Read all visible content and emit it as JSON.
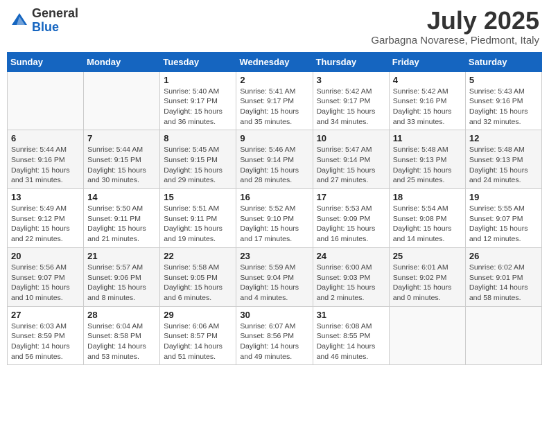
{
  "header": {
    "logo_general": "General",
    "logo_blue": "Blue",
    "month_year": "July 2025",
    "location": "Garbagna Novarese, Piedmont, Italy"
  },
  "calendar": {
    "days_of_week": [
      "Sunday",
      "Monday",
      "Tuesday",
      "Wednesday",
      "Thursday",
      "Friday",
      "Saturday"
    ],
    "weeks": [
      [
        {
          "day": "",
          "info": ""
        },
        {
          "day": "",
          "info": ""
        },
        {
          "day": "1",
          "info": "Sunrise: 5:40 AM\nSunset: 9:17 PM\nDaylight: 15 hours\nand 36 minutes."
        },
        {
          "day": "2",
          "info": "Sunrise: 5:41 AM\nSunset: 9:17 PM\nDaylight: 15 hours\nand 35 minutes."
        },
        {
          "day": "3",
          "info": "Sunrise: 5:42 AM\nSunset: 9:17 PM\nDaylight: 15 hours\nand 34 minutes."
        },
        {
          "day": "4",
          "info": "Sunrise: 5:42 AM\nSunset: 9:16 PM\nDaylight: 15 hours\nand 33 minutes."
        },
        {
          "day": "5",
          "info": "Sunrise: 5:43 AM\nSunset: 9:16 PM\nDaylight: 15 hours\nand 32 minutes."
        }
      ],
      [
        {
          "day": "6",
          "info": "Sunrise: 5:44 AM\nSunset: 9:16 PM\nDaylight: 15 hours\nand 31 minutes."
        },
        {
          "day": "7",
          "info": "Sunrise: 5:44 AM\nSunset: 9:15 PM\nDaylight: 15 hours\nand 30 minutes."
        },
        {
          "day": "8",
          "info": "Sunrise: 5:45 AM\nSunset: 9:15 PM\nDaylight: 15 hours\nand 29 minutes."
        },
        {
          "day": "9",
          "info": "Sunrise: 5:46 AM\nSunset: 9:14 PM\nDaylight: 15 hours\nand 28 minutes."
        },
        {
          "day": "10",
          "info": "Sunrise: 5:47 AM\nSunset: 9:14 PM\nDaylight: 15 hours\nand 27 minutes."
        },
        {
          "day": "11",
          "info": "Sunrise: 5:48 AM\nSunset: 9:13 PM\nDaylight: 15 hours\nand 25 minutes."
        },
        {
          "day": "12",
          "info": "Sunrise: 5:48 AM\nSunset: 9:13 PM\nDaylight: 15 hours\nand 24 minutes."
        }
      ],
      [
        {
          "day": "13",
          "info": "Sunrise: 5:49 AM\nSunset: 9:12 PM\nDaylight: 15 hours\nand 22 minutes."
        },
        {
          "day": "14",
          "info": "Sunrise: 5:50 AM\nSunset: 9:11 PM\nDaylight: 15 hours\nand 21 minutes."
        },
        {
          "day": "15",
          "info": "Sunrise: 5:51 AM\nSunset: 9:11 PM\nDaylight: 15 hours\nand 19 minutes."
        },
        {
          "day": "16",
          "info": "Sunrise: 5:52 AM\nSunset: 9:10 PM\nDaylight: 15 hours\nand 17 minutes."
        },
        {
          "day": "17",
          "info": "Sunrise: 5:53 AM\nSunset: 9:09 PM\nDaylight: 15 hours\nand 16 minutes."
        },
        {
          "day": "18",
          "info": "Sunrise: 5:54 AM\nSunset: 9:08 PM\nDaylight: 15 hours\nand 14 minutes."
        },
        {
          "day": "19",
          "info": "Sunrise: 5:55 AM\nSunset: 9:07 PM\nDaylight: 15 hours\nand 12 minutes."
        }
      ],
      [
        {
          "day": "20",
          "info": "Sunrise: 5:56 AM\nSunset: 9:07 PM\nDaylight: 15 hours\nand 10 minutes."
        },
        {
          "day": "21",
          "info": "Sunrise: 5:57 AM\nSunset: 9:06 PM\nDaylight: 15 hours\nand 8 minutes."
        },
        {
          "day": "22",
          "info": "Sunrise: 5:58 AM\nSunset: 9:05 PM\nDaylight: 15 hours\nand 6 minutes."
        },
        {
          "day": "23",
          "info": "Sunrise: 5:59 AM\nSunset: 9:04 PM\nDaylight: 15 hours\nand 4 minutes."
        },
        {
          "day": "24",
          "info": "Sunrise: 6:00 AM\nSunset: 9:03 PM\nDaylight: 15 hours\nand 2 minutes."
        },
        {
          "day": "25",
          "info": "Sunrise: 6:01 AM\nSunset: 9:02 PM\nDaylight: 15 hours\nand 0 minutes."
        },
        {
          "day": "26",
          "info": "Sunrise: 6:02 AM\nSunset: 9:01 PM\nDaylight: 14 hours\nand 58 minutes."
        }
      ],
      [
        {
          "day": "27",
          "info": "Sunrise: 6:03 AM\nSunset: 8:59 PM\nDaylight: 14 hours\nand 56 minutes."
        },
        {
          "day": "28",
          "info": "Sunrise: 6:04 AM\nSunset: 8:58 PM\nDaylight: 14 hours\nand 53 minutes."
        },
        {
          "day": "29",
          "info": "Sunrise: 6:06 AM\nSunset: 8:57 PM\nDaylight: 14 hours\nand 51 minutes."
        },
        {
          "day": "30",
          "info": "Sunrise: 6:07 AM\nSunset: 8:56 PM\nDaylight: 14 hours\nand 49 minutes."
        },
        {
          "day": "31",
          "info": "Sunrise: 6:08 AM\nSunset: 8:55 PM\nDaylight: 14 hours\nand 46 minutes."
        },
        {
          "day": "",
          "info": ""
        },
        {
          "day": "",
          "info": ""
        }
      ]
    ]
  }
}
